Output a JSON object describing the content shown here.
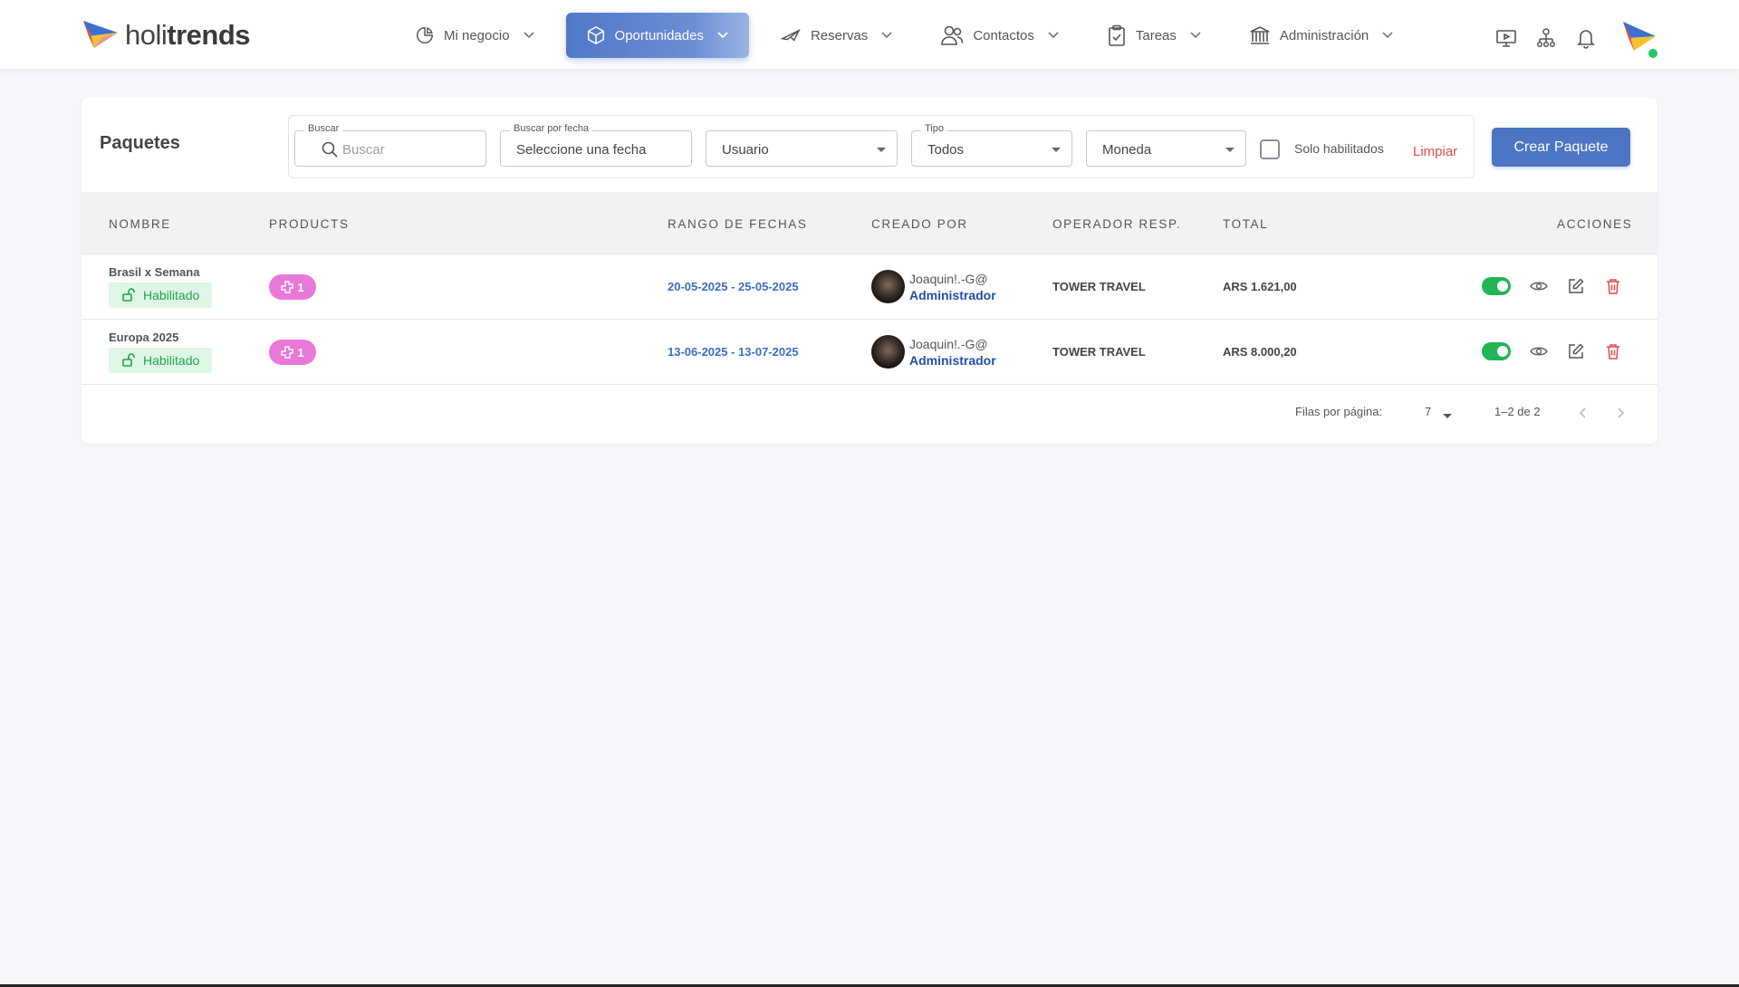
{
  "app": {
    "logo_light": "holi",
    "logo_bold": "trends"
  },
  "nav": {
    "items": [
      {
        "label": "Mi negocio",
        "icon": "pie-chart-icon"
      },
      {
        "label": "Oportunidades",
        "icon": "cube-icon",
        "active": true
      },
      {
        "label": "Reservas",
        "icon": "plane-icon"
      },
      {
        "label": "Contactos",
        "icon": "users-icon"
      },
      {
        "label": "Tareas",
        "icon": "clipboard-icon"
      },
      {
        "label": "Administración",
        "icon": "bank-icon"
      }
    ],
    "right_icons": [
      "monitor-play-icon",
      "org-chart-icon",
      "bell-icon"
    ],
    "accent": "#4f78c8"
  },
  "page": {
    "title": "Paquetes",
    "create_button": "Crear Paquete",
    "clear_link": "Limpiar"
  },
  "filters": {
    "search": {
      "label": "Buscar",
      "placeholder": "Buscar"
    },
    "date": {
      "label": "Buscar por fecha",
      "value": "Seleccione una fecha"
    },
    "user": {
      "value": "Usuario"
    },
    "type": {
      "label": "Tipo",
      "value": "Todos"
    },
    "currency": {
      "value": "Moneda"
    },
    "only_enabled": {
      "label": "Solo habilitados",
      "checked": false
    }
  },
  "table": {
    "headers": {
      "name": "NOMBRE",
      "products": "PRODUCTS",
      "dates": "RANGO DE FECHAS",
      "created_by": "CREADO POR",
      "operator": "OPERADOR RESP.",
      "total": "TOTAL",
      "actions": "ACCIONES"
    },
    "rows": [
      {
        "name": "Brasil x Semana",
        "status": "Habilitado",
        "products": "1",
        "dates": "20-05-2025 - 25-05-2025",
        "creator_name": "Joaquin!.-G@",
        "creator_role": "Administrador",
        "operator": "TOWER TRAVEL",
        "total": "ARS 1.621,00",
        "enabled": true
      },
      {
        "name": "Europa 2025",
        "status": "Habilitado",
        "products": "1",
        "dates": "13-06-2025 - 13-07-2025",
        "creator_name": "Joaquin!.-G@",
        "creator_role": "Administrador",
        "operator": "TOWER TRAVEL",
        "total": "ARS 8.000,20",
        "enabled": true
      }
    ]
  },
  "pagination": {
    "rows_label": "Filas por página:",
    "rows_value": "7",
    "range": "1–2 de 2"
  },
  "colors": {
    "primary": "#4c75c3",
    "success": "#22b455",
    "danger": "#e14b4b",
    "pill": "#e879d9"
  }
}
